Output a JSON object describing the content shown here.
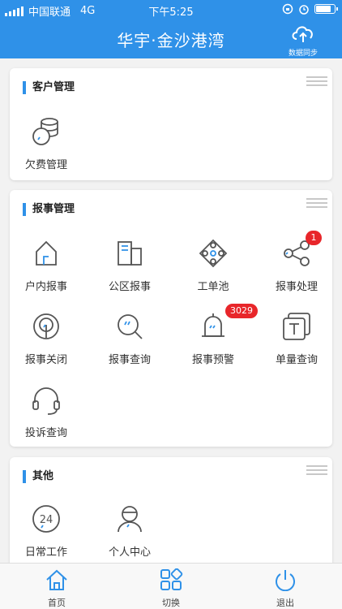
{
  "statusbar": {
    "carrier": "中国联通",
    "network": "4G",
    "time": "下午5:25"
  },
  "header": {
    "title": "华宇·金沙港湾",
    "sync_label": "数据同步"
  },
  "sections": [
    {
      "title": "客户管理",
      "items": [
        {
          "label": "欠费管理",
          "icon": "coins-icon"
        }
      ]
    },
    {
      "title": "报事管理",
      "items": [
        {
          "label": "户内报事",
          "icon": "house-icon"
        },
        {
          "label": "公区报事",
          "icon": "building-icon"
        },
        {
          "label": "工单池",
          "icon": "work-pool-icon"
        },
        {
          "label": "报事处理",
          "icon": "share-nodes-icon",
          "badge": "1"
        },
        {
          "label": "报事关闭",
          "icon": "location-close-icon"
        },
        {
          "label": "报事查询",
          "icon": "magnifier-icon"
        },
        {
          "label": "报事预警",
          "icon": "bell-icon",
          "badge": "3029"
        },
        {
          "label": "单量查询",
          "icon": "documents-icon"
        },
        {
          "label": "投诉查询",
          "icon": "headset-icon"
        }
      ]
    },
    {
      "title": "其他",
      "items": [
        {
          "label": "日常工作",
          "icon": "clock-24-icon"
        },
        {
          "label": "个人中心",
          "icon": "person-icon"
        }
      ]
    }
  ],
  "tabbar": [
    {
      "label": "首页",
      "icon": "home-icon"
    },
    {
      "label": "切换",
      "icon": "switch-grid-icon"
    },
    {
      "label": "退出",
      "icon": "power-icon"
    }
  ],
  "colors": {
    "primary": "#2f91e8",
    "badge": "#e8262a",
    "icon_gray": "#555555"
  }
}
